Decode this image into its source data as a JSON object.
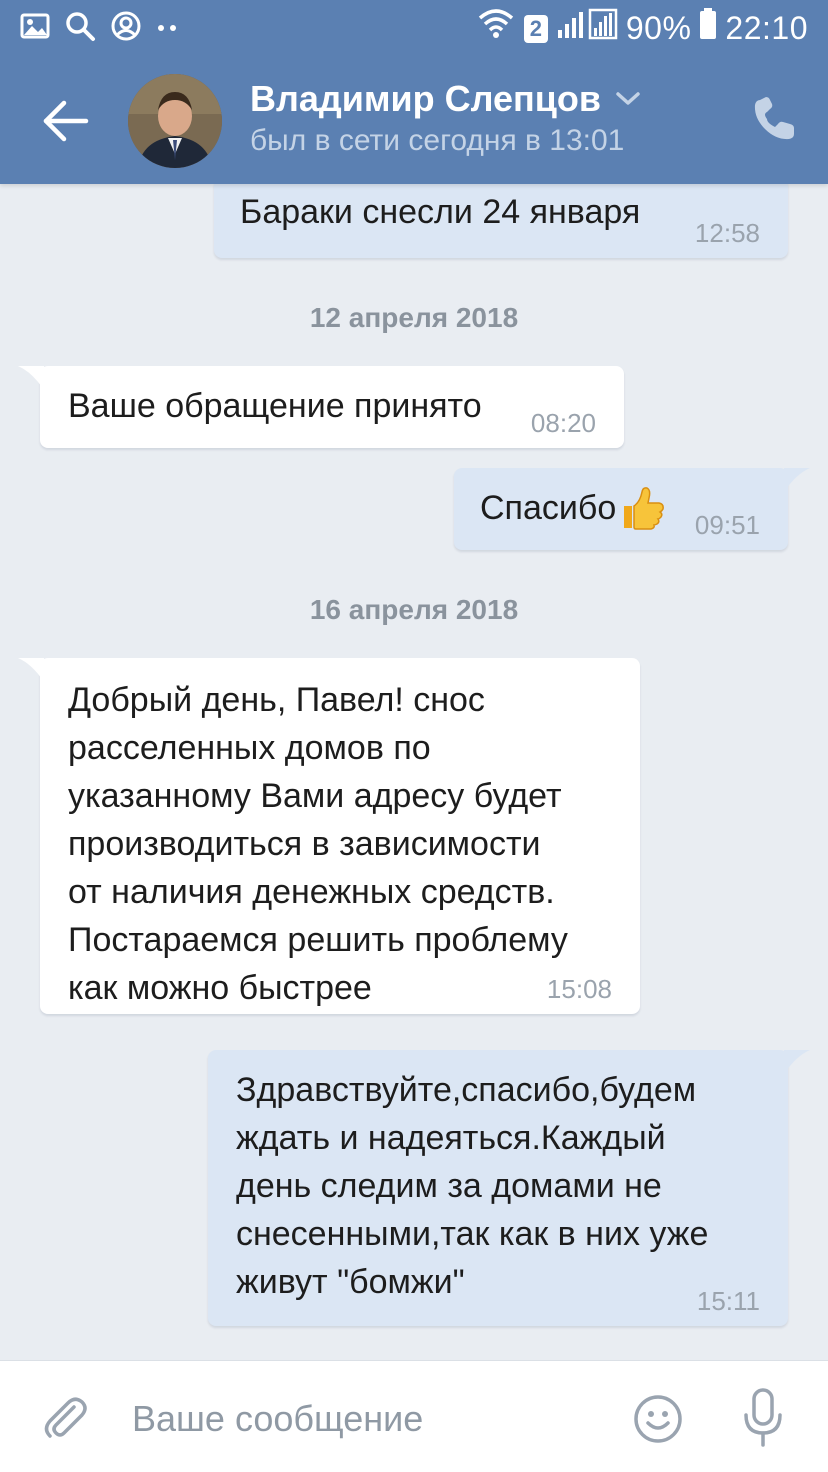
{
  "status_bar": {
    "sim_badge": "2",
    "battery": "90%",
    "time": "22:10",
    "icons": [
      "gallery-icon",
      "search-icon",
      "account-icon",
      "more-dots-icon",
      "wifi-icon",
      "signal-icon",
      "battery-icon"
    ]
  },
  "header": {
    "contact_name": "Владимир Слепцов",
    "contact_status": "был в сети сегодня в 13:01",
    "icons": [
      "back-arrow-icon",
      "avatar",
      "chevron-down-icon",
      "phone-icon"
    ]
  },
  "messages": [
    {
      "direction": "out",
      "text": "Бараки снесли 24 января",
      "time": "12:58"
    },
    {
      "type": "date",
      "label": "12 апреля 2018"
    },
    {
      "direction": "in",
      "text": "Ваше обращение принято",
      "time": "08:20"
    },
    {
      "direction": "out",
      "text": "Спасибо",
      "emoji": "thumbs-up-icon",
      "time": "09:51"
    },
    {
      "type": "date",
      "label": "16 апреля 2018"
    },
    {
      "direction": "in",
      "text": "Добрый день, Павел! снос\nрасселенных домов по\nуказанному Вами адресу будет\nпроизводиться в зависимости\nот наличия денежных средств.\nПостараемся решить проблему\nкак можно быстрее",
      "time": "15:08"
    },
    {
      "direction": "out",
      "text": "Здравствуйте,спасибо,будем\nждать и надеяться.Каждый\nдень следим за домами не\nснесенными,так как в них уже\nживут \"бомжи\"",
      "time": "15:11"
    }
  ],
  "composer": {
    "placeholder": "Ваше сообщение",
    "icons": [
      "paperclip-icon",
      "emoji-icon",
      "microphone-icon"
    ]
  },
  "colors": {
    "header_bg": "#5b80b2",
    "chat_bg": "#e9edf2",
    "incoming_bubble": "#ffffff",
    "outgoing_bubble": "#dbe6f4",
    "timestamp": "#9aa3ad",
    "date_separator": "#8a939d"
  }
}
